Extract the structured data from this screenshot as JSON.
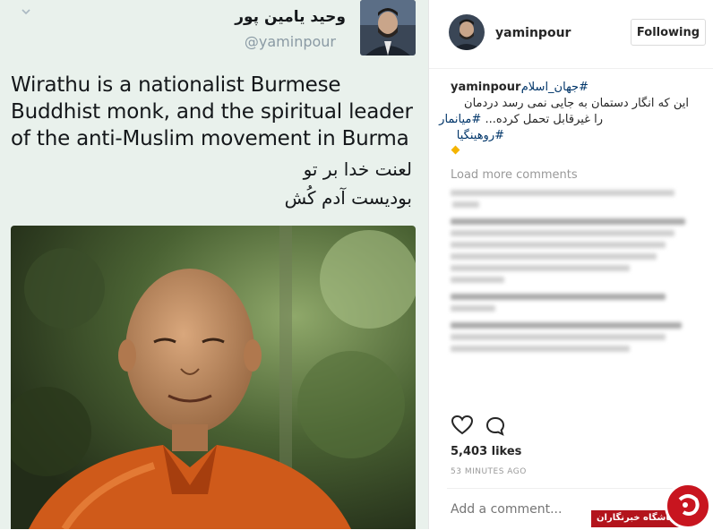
{
  "tweet": {
    "name": "وحید یامین پور",
    "handle": "@yaminpour",
    "text": "Wirathu is a nationalist Burmese Buddhist monk, and the spiritual leader of the anti-Muslim movement in Burma",
    "fa_line1": "لعنت خدا بر تو",
    "fa_line2": "بودیست آدم کُش"
  },
  "instagram": {
    "username": "yaminpour",
    "follow_label": "Following",
    "caption_user": "yaminpour",
    "caption_tag1": "#جهان_اسلام",
    "caption_line1": "این که انگار دستمان به جایی نمی رسد دردمان",
    "caption_line2_text": "را غیرقابل تحمل کرده...",
    "caption_line2_tag": "#میانمار",
    "caption_line3_tag": "#روهینگیا",
    "load_more": "Load more comments",
    "likes": "5,403 likes",
    "time": "53 MINUTES AGO",
    "comment_placeholder": "Add a comment..."
  },
  "watermark": {
    "text": "باشگاه خبرنگاران"
  },
  "icons": {
    "heart": "heart-icon",
    "comment": "comment-icon",
    "chevron": "chevron-down-icon"
  },
  "colors": {
    "tweet_bg": "#e9f1ec",
    "hashtag": "#003569",
    "watermark_red": "#c8151f"
  }
}
